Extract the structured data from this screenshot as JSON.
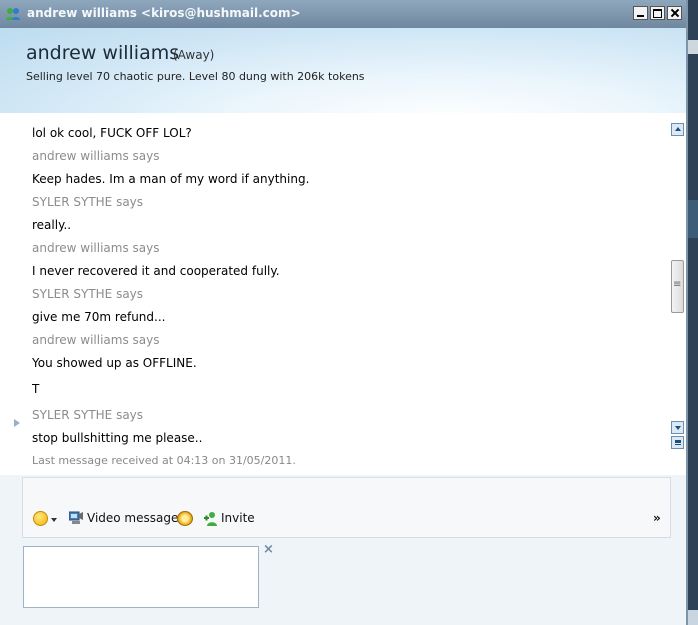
{
  "window": {
    "title": "andrew williams <kiros@hushmail.com>"
  },
  "contact": {
    "name": "andrew williams",
    "status": "(Away)",
    "personal_message": "Selling level 70 chaotic pure. Level 80 dung with 206k tokens"
  },
  "conversation": {
    "messages": [
      {
        "sender": "",
        "text": "lol ok cool, FUCK OFF LOL?"
      },
      {
        "sender": "andrew williams says",
        "text": "Keep hades. Im a man of my word if anything."
      },
      {
        "sender": "SYLER SYTHE says",
        "text": "really.."
      },
      {
        "sender": "andrew williams says",
        "text": "I never recovered it and cooperated fully."
      },
      {
        "sender": "SYLER SYTHE says",
        "text": "give me 70m refund..."
      },
      {
        "sender": "andrew williams says",
        "text": "You showed up as OFFLINE.",
        "extra": "T"
      },
      {
        "sender": "SYLER SYTHE says",
        "text": "stop bullshitting me please.."
      }
    ],
    "last_received": "Last message received at 04:13 on 31/05/2011."
  },
  "toolbar": {
    "video_message_label": "Video message",
    "invite_label": "Invite",
    "more_label": "»"
  },
  "input": {
    "close_label": "×",
    "value": ""
  },
  "icons": {
    "emoticon": "emoticon-icon",
    "video": "video-message-icon",
    "nudge": "nudge-icon",
    "invite": "invite-icon"
  }
}
